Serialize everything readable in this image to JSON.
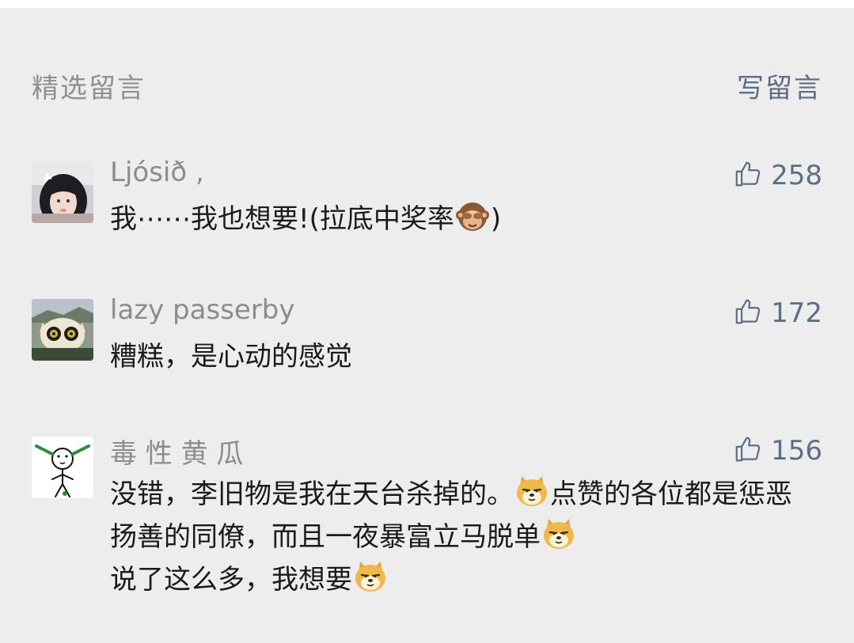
{
  "header": {
    "title": "精选留言",
    "write_label": "写留言"
  },
  "comments": [
    {
      "nickname": "Ljósið ,",
      "likes": "258",
      "text_parts": [
        "我⋯⋯我也想要!(拉底中奖率",
        ")"
      ],
      "emoji": "see-no-evil-monkey"
    },
    {
      "nickname": "lazy passerby",
      "likes": "172",
      "text_parts": [
        "糟糕，是心动的感觉"
      ]
    },
    {
      "nickname": "毒 性 黄 瓜",
      "likes": "156",
      "text_parts": [
        "没错，李旧物是我在天台杀掉的。",
        "点赞的各位都是惩恶扬善的同僚，而且一夜暴富立马脱单",
        "说了这么多，我想要"
      ],
      "emoji": "doge"
    }
  ],
  "colors": {
    "background": "#ededed",
    "link": "#5d6d85",
    "nickname": "#8c8c8c",
    "text": "#1a1a1a"
  }
}
